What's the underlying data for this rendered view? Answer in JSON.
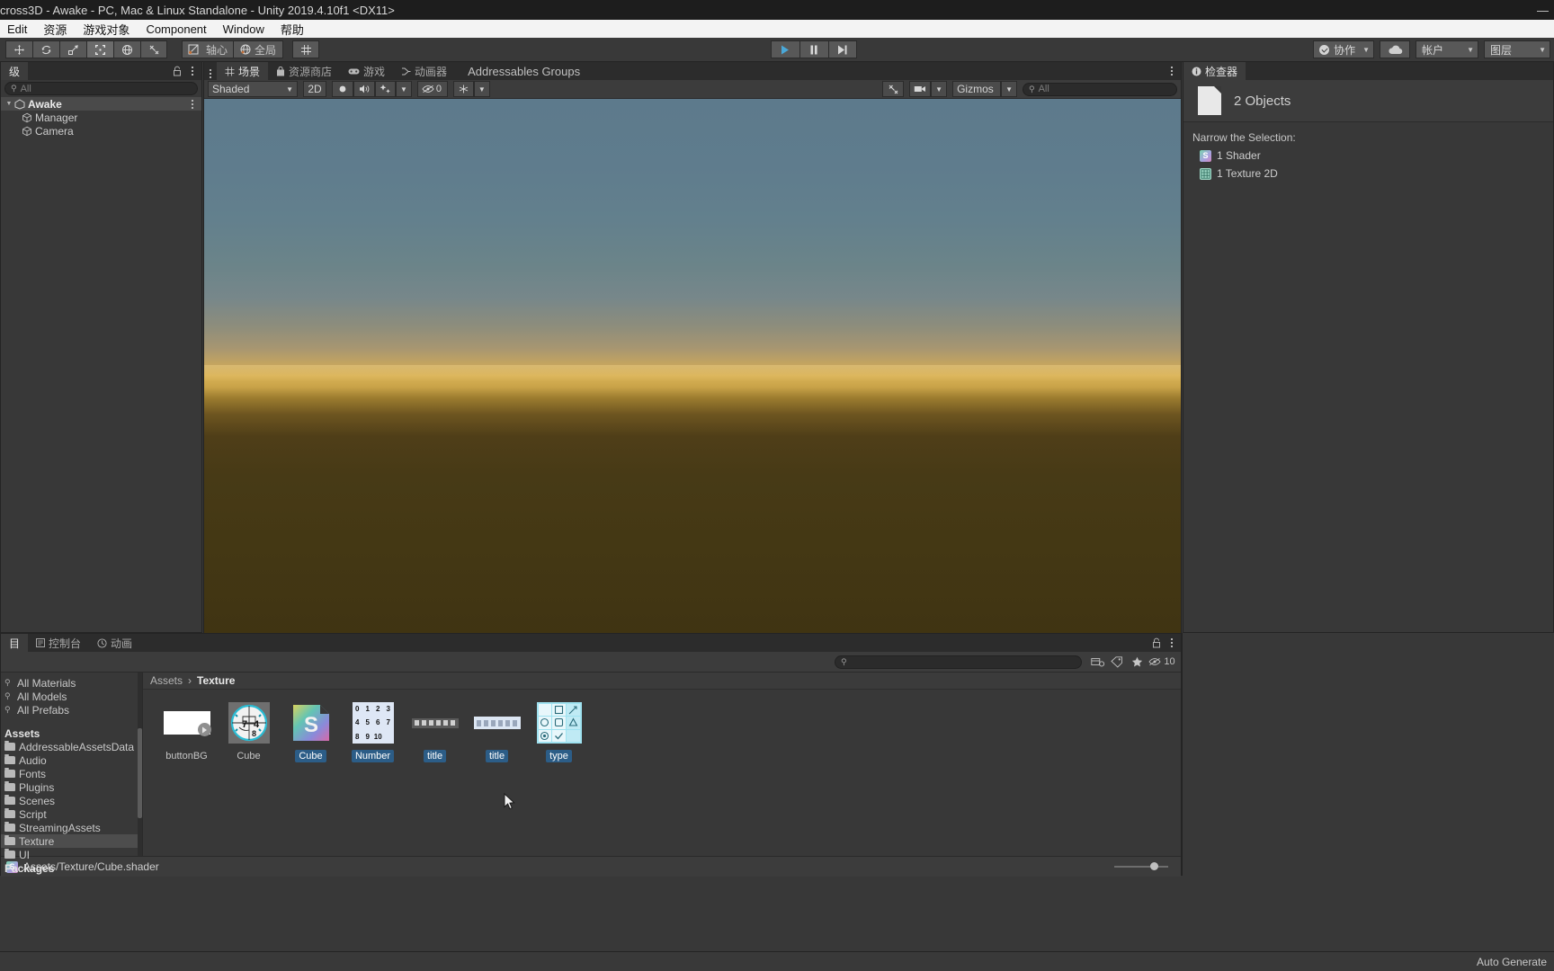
{
  "window": {
    "title": "cross3D - Awake - PC, Mac & Linux Standalone - Unity 2019.4.10f1 <DX11>",
    "minimize": "—"
  },
  "menu": {
    "items": [
      "Edit",
      "资源",
      "游戏对象",
      "Component",
      "Window",
      "帮助"
    ]
  },
  "toolbar": {
    "tools": [
      "hand-tool",
      "move-tool",
      "rotate-tool",
      "scale-tool",
      "rect-tool",
      "transform-tool",
      "custom-tool"
    ],
    "pivot_label": "轴心",
    "space_label": "全局",
    "play": "▶",
    "pause": "❙❙",
    "step": "▶❘",
    "collab_label": "协作",
    "cloud_icon": "cloud-icon",
    "account_label": "帐户",
    "layers_label": "图层"
  },
  "hierarchy": {
    "tab_label": "级",
    "search_placeholder": "All",
    "lock_icon": "lock-icon",
    "items": [
      {
        "label": "Awake",
        "depth": 0,
        "selected": true,
        "icon": "unity-scene-icon"
      },
      {
        "label": "Manager",
        "depth": 1,
        "selected": false,
        "icon": "gameobject-icon"
      },
      {
        "label": "Camera",
        "depth": 1,
        "selected": false,
        "icon": "gameobject-icon"
      }
    ]
  },
  "scene": {
    "tabs": [
      {
        "label": "场景",
        "active": true,
        "icon": "scene-grid-icon"
      },
      {
        "label": "资源商店",
        "active": false,
        "icon": "asset-store-icon"
      },
      {
        "label": "游戏",
        "active": false,
        "icon": "gamepad-icon"
      },
      {
        "label": "动画器",
        "active": false,
        "icon": "animator-icon"
      },
      {
        "label": "Addressables Groups",
        "active": false,
        "icon": ""
      }
    ],
    "draw_mode": "Shaded",
    "toggle_2d": "2D",
    "lighting_icon": "lighting-icon",
    "audio_icon": "audio-icon",
    "fx_icon": "effects-icon",
    "hidden_count": "0",
    "scene_vis_icon": "visibility-icon",
    "camera_icon": "camera-icon",
    "gizmos_label": "Gizmos",
    "search_placeholder": "All"
  },
  "inspector": {
    "tab_label": "检查器",
    "object_count": "2 Objects",
    "narrow_label": "Narrow the Selection:",
    "entries": [
      {
        "label": "1 Shader",
        "icon": "shader-icon",
        "badge": "S"
      },
      {
        "label": "1 Texture 2D",
        "icon": "texture2d-icon",
        "badge": ""
      }
    ]
  },
  "project": {
    "tabs": [
      {
        "label": "目",
        "active": true,
        "icon": ""
      },
      {
        "label": "控制台",
        "active": false,
        "icon": "console-icon"
      },
      {
        "label": "动画",
        "active": false,
        "icon": "animation-icon"
      }
    ],
    "search_placeholder": "",
    "favorite_icon": "star-icon",
    "label_icon": "tag-icon",
    "packages_icon": "packages-icon",
    "visible_count": "10",
    "breadcrumb": {
      "root": "Assets",
      "sep": "›",
      "current": "Texture"
    },
    "tree": [
      {
        "label": "All Materials",
        "type": "search",
        "bold": false,
        "selected": false,
        "depth": 0
      },
      {
        "label": "All Models",
        "type": "search",
        "bold": false,
        "selected": false,
        "depth": 0
      },
      {
        "label": "All Prefabs",
        "type": "search",
        "bold": false,
        "selected": false,
        "depth": 0
      },
      {
        "label": "Assets",
        "type": "root",
        "bold": true,
        "selected": false,
        "depth": 0
      },
      {
        "label": "AddressableAssetsData",
        "type": "folder",
        "bold": false,
        "selected": false,
        "depth": 1
      },
      {
        "label": "Audio",
        "type": "folder",
        "bold": false,
        "selected": false,
        "depth": 1
      },
      {
        "label": "Fonts",
        "type": "folder",
        "bold": false,
        "selected": false,
        "depth": 1
      },
      {
        "label": "Plugins",
        "type": "folder",
        "bold": false,
        "selected": false,
        "depth": 1
      },
      {
        "label": "Scenes",
        "type": "folder",
        "bold": false,
        "selected": false,
        "depth": 1
      },
      {
        "label": "Script",
        "type": "folder",
        "bold": false,
        "selected": false,
        "depth": 1
      },
      {
        "label": "StreamingAssets",
        "type": "folder",
        "bold": false,
        "selected": false,
        "depth": 1
      },
      {
        "label": "Texture",
        "type": "folder",
        "bold": false,
        "selected": true,
        "depth": 1
      },
      {
        "label": "UI",
        "type": "folder",
        "bold": false,
        "selected": false,
        "depth": 1
      },
      {
        "label": "Packages",
        "type": "root",
        "bold": true,
        "selected": false,
        "depth": 0
      }
    ],
    "assets": [
      {
        "label": "buttonBG",
        "kind": "texture-white",
        "selected": false
      },
      {
        "label": "Cube",
        "kind": "normalmap-sphere",
        "selected": false
      },
      {
        "label": "Cube",
        "kind": "shader",
        "selected": true
      },
      {
        "label": "Number",
        "kind": "number-atlas",
        "selected": true,
        "numbers": [
          "0",
          "1",
          "2",
          "3",
          "4",
          "5",
          "6",
          "7",
          "8",
          "9",
          "10"
        ]
      },
      {
        "label": "title",
        "kind": "title-dark",
        "selected": true
      },
      {
        "label": "title",
        "kind": "title-light",
        "selected": true
      },
      {
        "label": "type",
        "kind": "type-atlas",
        "selected": true
      }
    ],
    "status_path": "Assets/Texture/Cube.shader",
    "status_badge": "S"
  },
  "appstatus": {
    "auto_generate": "Auto Generate"
  }
}
